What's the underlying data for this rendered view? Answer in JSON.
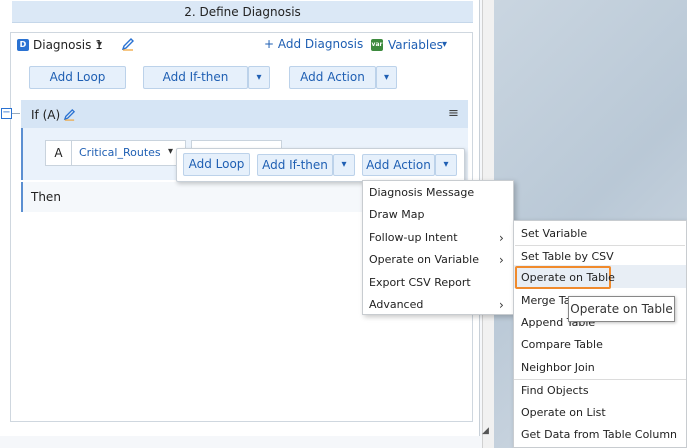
{
  "header": {
    "title": "2. Define Diagnosis"
  },
  "diagnosis": {
    "badge": "D",
    "name": "Diagnosis 1",
    "chevron": "▾",
    "add_label": "+ Add Diagnosis",
    "var_badge": "var",
    "variables_label": "Variables",
    "variables_chevron": "▾"
  },
  "toolbar": {
    "add_loop": "Add Loop",
    "add_ifthen": "Add If-then",
    "add_action": "Add Action",
    "dropdown_glyph": "▾"
  },
  "if_block": {
    "collapse_glyph": "−",
    "label": "If (A)",
    "menu_glyph": "≡",
    "condition_var": "A",
    "condition_field": "Critical_Routes",
    "condition_chevron": "▾",
    "then_label": "Then"
  },
  "popup": {
    "add_loop": "Add Loop",
    "add_ifthen": "Add If-then",
    "add_action": "Add Action",
    "dropdown_glyph": "▾"
  },
  "action_menu": {
    "items": [
      {
        "label": "Diagnosis Message",
        "submenu": false
      },
      {
        "label": "Draw Map",
        "submenu": false
      },
      {
        "label": "Follow-up Intent",
        "submenu": true
      },
      {
        "label": "Operate on Variable",
        "submenu": true
      },
      {
        "label": "Export CSV Report",
        "submenu": false
      },
      {
        "label": "Advanced",
        "submenu": true
      }
    ],
    "arrow_glyph": "›"
  },
  "variable_submenu": {
    "items": [
      {
        "label": "Set Variable"
      },
      {
        "label": "Set Table by CSV"
      },
      {
        "label": "Operate on Table",
        "selected": true
      },
      {
        "label": "Merge Table"
      },
      {
        "label": "Append Table"
      },
      {
        "label": "Compare Table"
      },
      {
        "label": "Neighbor Join"
      },
      {
        "label": "Find Objects"
      },
      {
        "label": "Operate on List"
      },
      {
        "label": "Get Data from Table Column"
      }
    ]
  },
  "tooltip": {
    "text": "Operate on Table"
  },
  "colors": {
    "accent": "#1f5fb3",
    "highlight_border": "#f08a2c",
    "header_bg": "#dbe8f6"
  },
  "icons": {
    "edit": "pencil-icon",
    "resize": "resize-grip-icon"
  }
}
